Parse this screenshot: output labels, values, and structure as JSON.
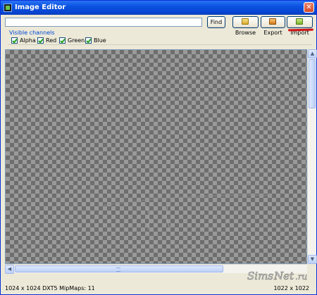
{
  "window": {
    "title": "Image Editor"
  },
  "toolbar": {
    "search_value": "",
    "find_label": "Find",
    "browse_label": "Browse",
    "export_label": "Export",
    "import_label": "Import"
  },
  "channels": {
    "group_label": "Visible channels",
    "items": [
      {
        "label": "Alpha",
        "checked": true
      },
      {
        "label": "Red",
        "checked": true
      },
      {
        "label": "Green",
        "checked": true
      },
      {
        "label": "Blue",
        "checked": true
      }
    ]
  },
  "status": {
    "left": "1024 x 1024 DXT5 MipMaps: 11",
    "right": "1022 x 1022"
  },
  "watermark": {
    "text": "SimsNet.ru"
  },
  "colors": {
    "titlebar": "#0a53e0",
    "highlight_underline": "#d11212",
    "checker_dark": "#6e6e6e",
    "checker_light": "#9a9a9a"
  }
}
